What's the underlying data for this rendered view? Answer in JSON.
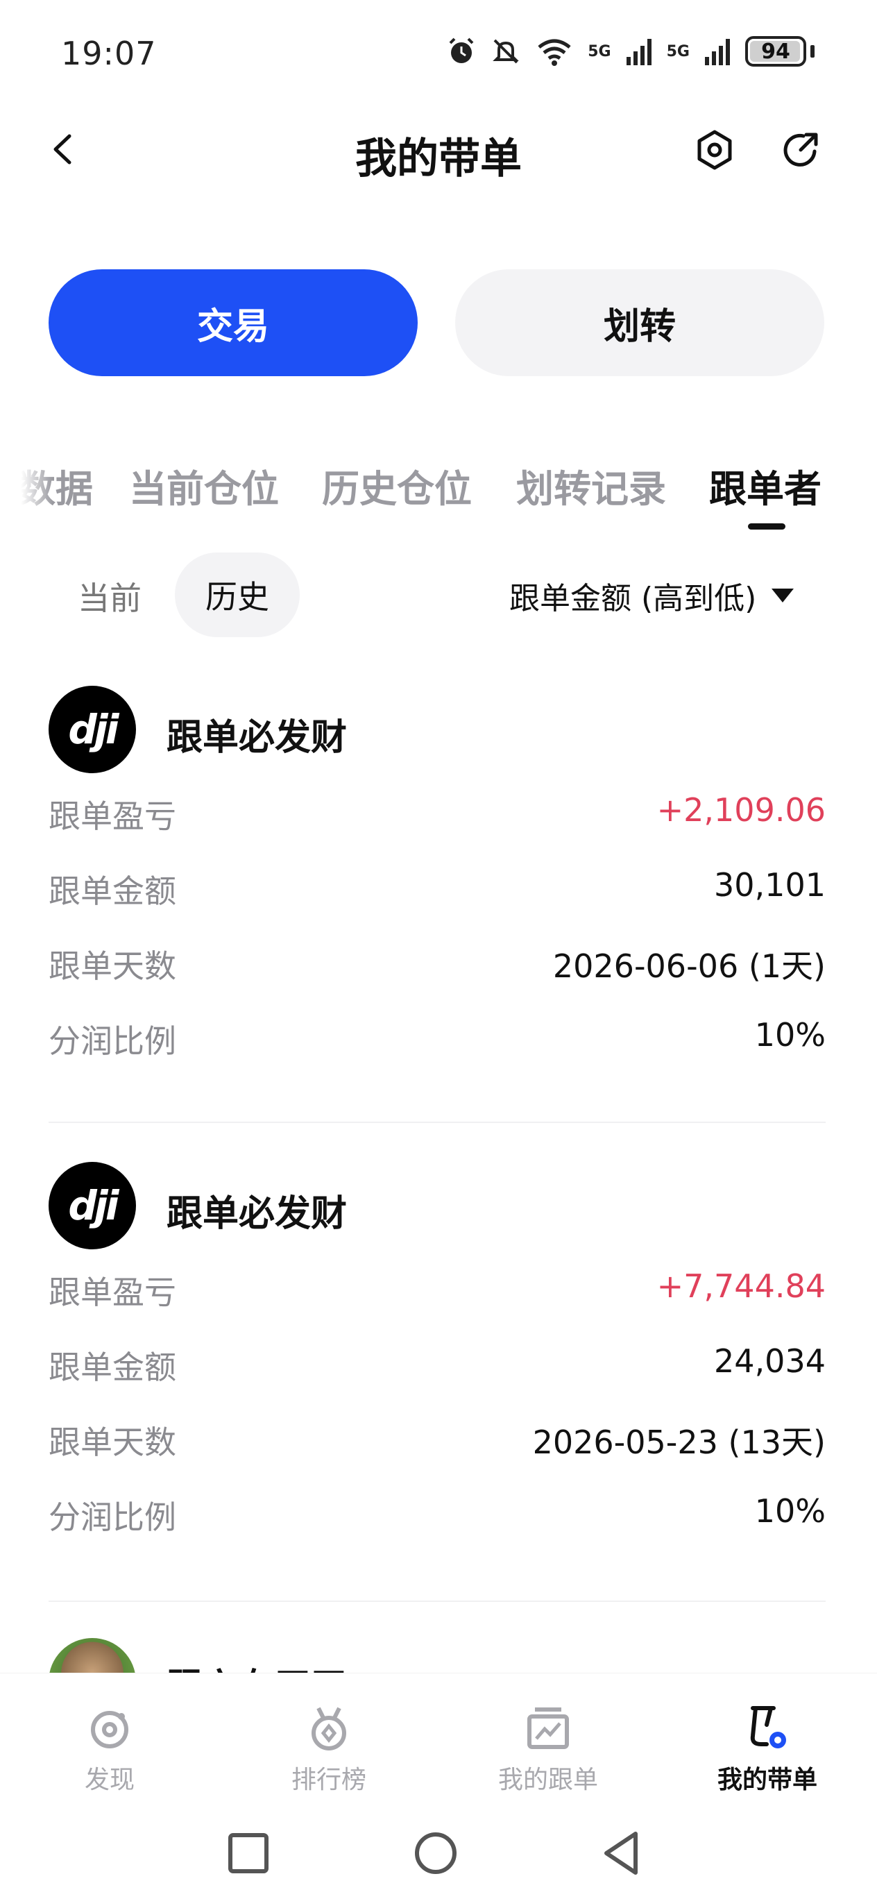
{
  "status_bar": {
    "time": "19:07",
    "network_a": "5G",
    "network_b": "5G",
    "battery": "94",
    "icons": [
      "alarm-icon",
      "mute-icon",
      "wifi-icon",
      "signal-5g-icon",
      "signal-5g-icon",
      "battery-icon"
    ]
  },
  "header": {
    "title": "我的带单",
    "icons": [
      "back-icon",
      "settings-icon",
      "share-icon"
    ]
  },
  "actions": {
    "trade_label": "交易",
    "transfer_label": "划转",
    "accent_color": "#1e50f5"
  },
  "tabs": [
    {
      "label": "数据"
    },
    {
      "label": "当前仓位"
    },
    {
      "label": "历史仓位"
    },
    {
      "label": "划转记录"
    },
    {
      "label": "跟单者",
      "active": true
    }
  ],
  "filters": {
    "current_label": "当前",
    "history_label": "历史",
    "sort_label": "跟单金额 (高到低)"
  },
  "followers": [
    {
      "avatar_text": "dji",
      "name": "跟单必发财",
      "rows": [
        {
          "label": "跟单盈亏",
          "value": "+2,109.06",
          "profit": true
        },
        {
          "label": "跟单金额",
          "value": "30,101"
        },
        {
          "label": "跟单天数",
          "value": "2026-06-06 (1天)"
        },
        {
          "label": "分润比例",
          "value": "10%"
        }
      ]
    },
    {
      "avatar_text": "dji",
      "name": "跟单必发财",
      "rows": [
        {
          "label": "跟单盈亏",
          "value": "+7,744.84",
          "profit": true
        },
        {
          "label": "跟单金额",
          "value": "24,034"
        },
        {
          "label": "跟单天数",
          "value": "2026-05-23 (13天)"
        },
        {
          "label": "分润比例",
          "value": "10%"
        }
      ]
    },
    {
      "name": "跟六有天天"
    }
  ],
  "profit_color": "#e0405a",
  "bottom_nav": [
    {
      "label": "发现",
      "icon": "discover-icon"
    },
    {
      "label": "排行榜",
      "icon": "leaderboard-icon"
    },
    {
      "label": "我的跟单",
      "icon": "my-copy-icon"
    },
    {
      "label": "我的带单",
      "icon": "my-lead-icon",
      "active": true
    }
  ],
  "system_nav": [
    "recent-apps-icon",
    "home-icon",
    "back-nav-icon"
  ]
}
